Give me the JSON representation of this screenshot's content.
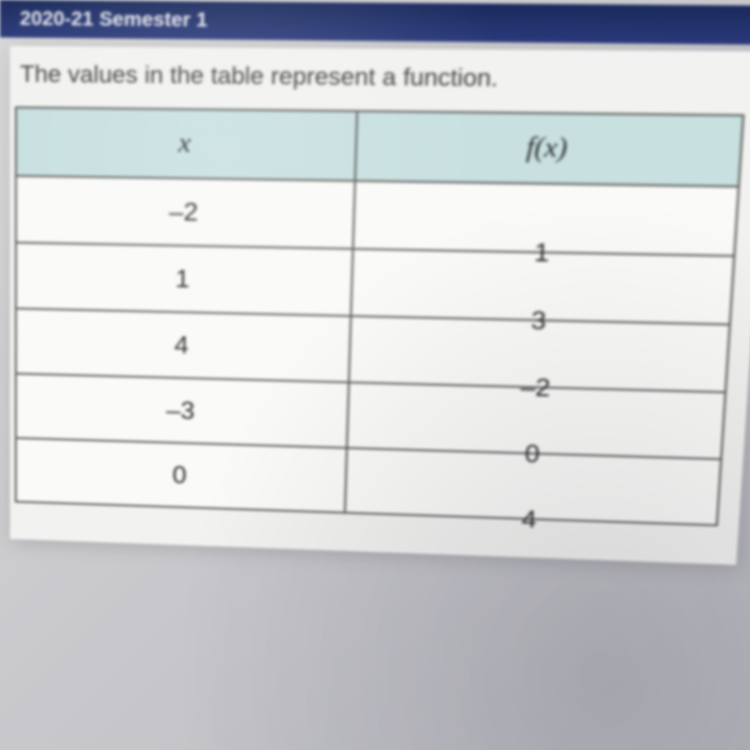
{
  "header": {
    "title": "2020-21 Semester 1"
  },
  "prompt": "The values in the table represent a function.",
  "chart_data": {
    "type": "table",
    "columns": [
      "x",
      "f(x)"
    ],
    "rows": [
      {
        "x": "–2",
        "fx": "1"
      },
      {
        "x": "1",
        "fx": "3"
      },
      {
        "x": "4",
        "fx": "–2"
      },
      {
        "x": "–3",
        "fx": "0"
      },
      {
        "x": "0",
        "fx": "4"
      }
    ]
  }
}
